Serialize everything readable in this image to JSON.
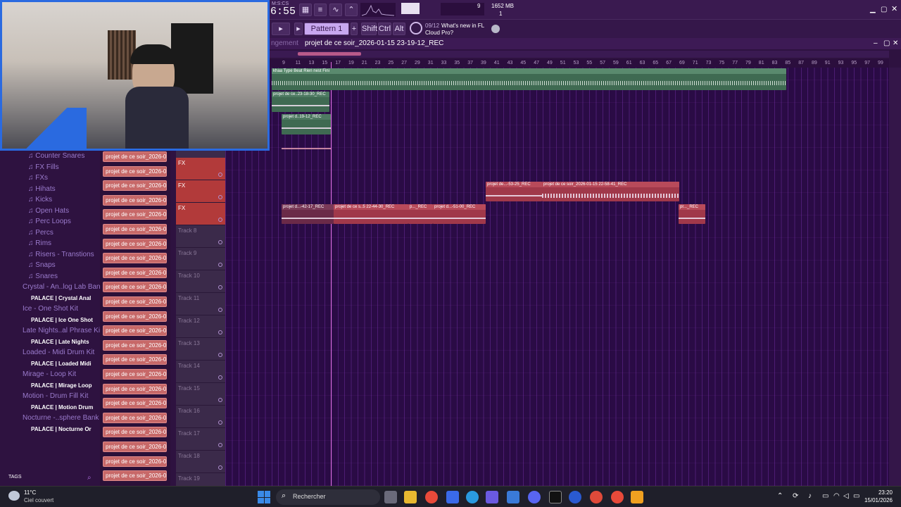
{
  "fl": {
    "time": "6:55",
    "time_label": "M:S:CS",
    "pattern": "Pattern 1",
    "keys": [
      "Shift",
      "Ctrl",
      "Alt"
    ],
    "news_counter": "09/12",
    "news_text": "What's new in FL",
    "news_sub": "Cloud Pro?",
    "cpu_value": "9",
    "ram": "1652 MB",
    "ram_sub": "1"
  },
  "playlist": {
    "breadcrumb_left": "ngement",
    "title": "projet de ce soir_2026-01-15 23-19-12_REC",
    "ruler": [
      "9",
      "11",
      "13",
      "15",
      "17",
      "19",
      "21",
      "23",
      "25",
      "27",
      "29",
      "31",
      "33",
      "35",
      "37",
      "39",
      "41",
      "43",
      "45",
      "47",
      "49",
      "51",
      "53",
      "55",
      "57",
      "59",
      "61",
      "63",
      "65",
      "67",
      "69",
      "71",
      "73",
      "75",
      "77",
      "79",
      "81",
      "83",
      "85",
      "87",
      "89",
      "91",
      "93",
      "95",
      "97",
      "99"
    ]
  },
  "browser": {
    "items": [
      {
        "label": "Counter Snares",
        "type": "folder"
      },
      {
        "label": "FX Fills",
        "type": "folder"
      },
      {
        "label": "FXs",
        "type": "folder"
      },
      {
        "label": "Hihats",
        "type": "folder"
      },
      {
        "label": "Kicks",
        "type": "folder"
      },
      {
        "label": "Open Hats",
        "type": "folder"
      },
      {
        "label": "Perc Loops",
        "type": "folder"
      },
      {
        "label": "Percs",
        "type": "folder"
      },
      {
        "label": "Rims",
        "type": "folder"
      },
      {
        "label": "Risers - Transtions",
        "type": "folder"
      },
      {
        "label": "Snaps",
        "type": "folder"
      },
      {
        "label": "Snares",
        "type": "folder"
      },
      {
        "label": "Crystal - An..log Lab Bank",
        "type": "pack"
      },
      {
        "label": "PALACE | Crystal Anal",
        "type": "palace"
      },
      {
        "label": "Ice - One Shot Kit",
        "type": "pack"
      },
      {
        "label": "PALACE | Ice One Shot",
        "type": "palace"
      },
      {
        "label": "Late Nights..al Phrase Kit",
        "type": "pack"
      },
      {
        "label": "PALACE | Late Nights",
        "type": "palace"
      },
      {
        "label": "Loaded - Midi Drum Kit",
        "type": "pack"
      },
      {
        "label": "PALACE | Loaded Midi",
        "type": "palace"
      },
      {
        "label": "Mirage - Loop Kit",
        "type": "pack"
      },
      {
        "label": "PALACE | Mirage Loop",
        "type": "palace"
      },
      {
        "label": "Motion - Drum Fill Kit",
        "type": "pack"
      },
      {
        "label": "PALACE | Motion Drum",
        "type": "palace"
      },
      {
        "label": "Nocturne -..sphere Bank",
        "type": "pack"
      },
      {
        "label": "PALACE | Nocturne Or",
        "type": "palace"
      }
    ],
    "tags_label": "TAGS"
  },
  "patterns": {
    "label": "projet de ce soir_2026-0...",
    "count": 23
  },
  "tracks": [
    {
      "label": "FX",
      "red": true
    },
    {
      "label": "FX",
      "red": true
    },
    {
      "label": "FX",
      "red": true
    },
    {
      "label": "Track 8",
      "red": false
    },
    {
      "label": "Track 9",
      "red": false
    },
    {
      "label": "Track 10",
      "red": false
    },
    {
      "label": "Track 11",
      "red": false
    },
    {
      "label": "Track 12",
      "red": false
    },
    {
      "label": "Track 13",
      "red": false
    },
    {
      "label": "Track 14",
      "red": false
    },
    {
      "label": "Track 15",
      "red": false
    },
    {
      "label": "Track 16",
      "red": false
    },
    {
      "label": "Track 17",
      "red": false
    },
    {
      "label": "Track 18",
      "red": false
    },
    {
      "label": "Track 19",
      "red": false
    }
  ],
  "clips": {
    "beat": "khaa Type Beat Rien nest Fini",
    "c1": "projet de ce..23-18-30_REC",
    "c2": "projet d..19-12_REC",
    "c3": "projet de...-53-25_REC",
    "c4": "projet de ce soir_2026-01-15 22-58-41_REC",
    "c5": "projet d...-42-17_REC",
    "c6": "projet de ce s..5 22-44-30_REC",
    "c7": "p..._REC",
    "c8": "projet d...-51-00_REC",
    "c9": "pr..._REC"
  },
  "taskbar": {
    "weather_temp": "11°C",
    "weather_desc": "Ciel couvert",
    "search": "Rechercher",
    "time": "23:20",
    "date": "15/01/2026"
  },
  "colors": {
    "accent": "#c76868",
    "grid": "#2a0b45",
    "green_clip": "#3f6a52",
    "red_clip": "#a0384a"
  }
}
